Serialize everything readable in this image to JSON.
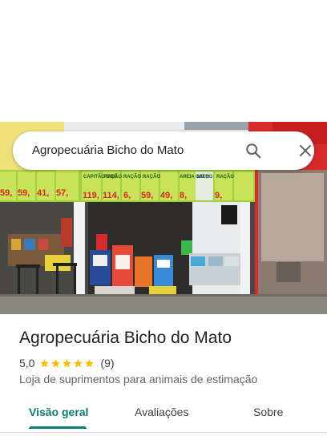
{
  "search": {
    "query": "Agropecuária Bicho do Mato"
  },
  "photo": {
    "signs": [
      "RAÇÃO",
      "CAPITÃO BOG",
      "RAÇÃO",
      "RAÇÃO",
      "RAÇÃO",
      "AREIA GATO",
      "MILHO",
      "RAÇÃO"
    ],
    "prices": [
      "59,",
      "59,",
      "41,",
      "57,",
      "119,",
      "114,",
      "6,",
      "59,",
      "49,",
      "8,",
      "9,"
    ]
  },
  "place": {
    "name": "Agropecuária Bicho do Mato",
    "rating": "5,0",
    "rating_value": 5.0,
    "review_count": "(9)",
    "category": "Loja de suprimentos para animais de estimação"
  },
  "tabs": [
    {
      "label": "Visão geral",
      "active": true
    },
    {
      "label": "Avaliações",
      "active": false
    },
    {
      "label": "Sobre",
      "active": false
    }
  ],
  "colors": {
    "accent": "#0b7a75",
    "star": "#fbbc04",
    "sign_green": "#b6d94a",
    "price_red": "#d8261c"
  },
  "icons": {
    "search": "search-icon",
    "close": "close-icon",
    "star": "star-icon"
  }
}
